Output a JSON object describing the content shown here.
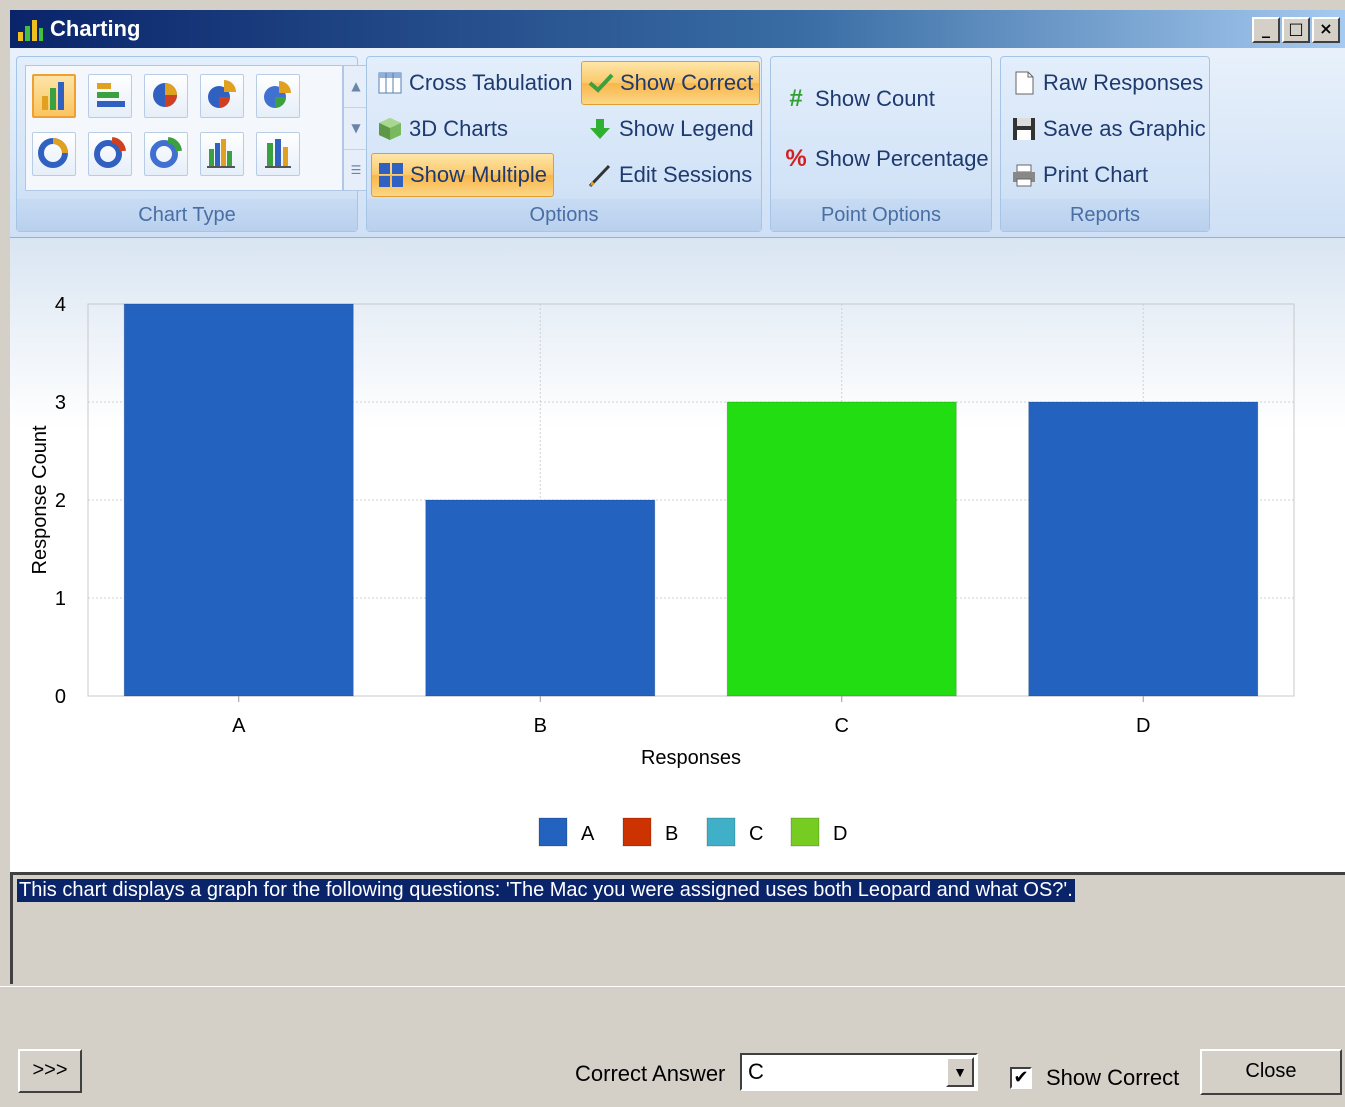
{
  "window": {
    "title": "Charting",
    "minimize_label": "_",
    "maximize_label": "□",
    "close_label": "×"
  },
  "ribbon": {
    "groups": {
      "chart_type": {
        "label": "Chart Type"
      },
      "options": {
        "label": "Options"
      },
      "point_options": {
        "label": "Point Options"
      },
      "reports": {
        "label": "Reports"
      }
    },
    "options": {
      "cross_tabulation": "Cross Tabulation",
      "show_correct": "Show Correct",
      "charts_3d": "3D Charts",
      "show_legend": "Show Legend",
      "show_multiple": "Show Multiple",
      "edit_sessions": "Edit Sessions"
    },
    "point_options": {
      "show_count": "Show Count",
      "show_percentage": "Show Percentage"
    },
    "reports": {
      "raw_responses": "Raw Responses",
      "save_as_graphic": "Save as Graphic",
      "print_chart": "Print Chart"
    }
  },
  "chart_data": {
    "type": "bar",
    "categories": [
      "A",
      "B",
      "C",
      "D"
    ],
    "values": [
      4,
      2,
      3,
      3
    ],
    "bar_colors": [
      "#2462c0",
      "#2462c0",
      "#22dd11",
      "#2462c0"
    ],
    "xlabel": "Responses",
    "ylabel": "Response Count",
    "ylim": [
      0,
      4
    ],
    "yticks": [
      0,
      1,
      2,
      3,
      4
    ],
    "grid": true,
    "legend": {
      "placement": "bottom-center",
      "entries": [
        {
          "name": "A",
          "color": "#2462c0"
        },
        {
          "name": "B",
          "color": "#cc3300"
        },
        {
          "name": "C",
          "color": "#40b0c8"
        },
        {
          "name": "D",
          "color": "#77cc22"
        }
      ]
    }
  },
  "description": "This chart displays a graph for the following questions: 'The Mac you were assigned uses both Leopard and what OS?'.",
  "bottom": {
    "expand_label": ">>>",
    "correct_answer_label": "Correct Answer",
    "correct_answer_value": "C",
    "show_correct_label": "Show Correct",
    "show_correct_checked": true,
    "close_label": "Close"
  },
  "colors": {
    "accent": "#0a246a",
    "ribbon": "#d2e3f7",
    "highlight": "#fbc86a"
  }
}
